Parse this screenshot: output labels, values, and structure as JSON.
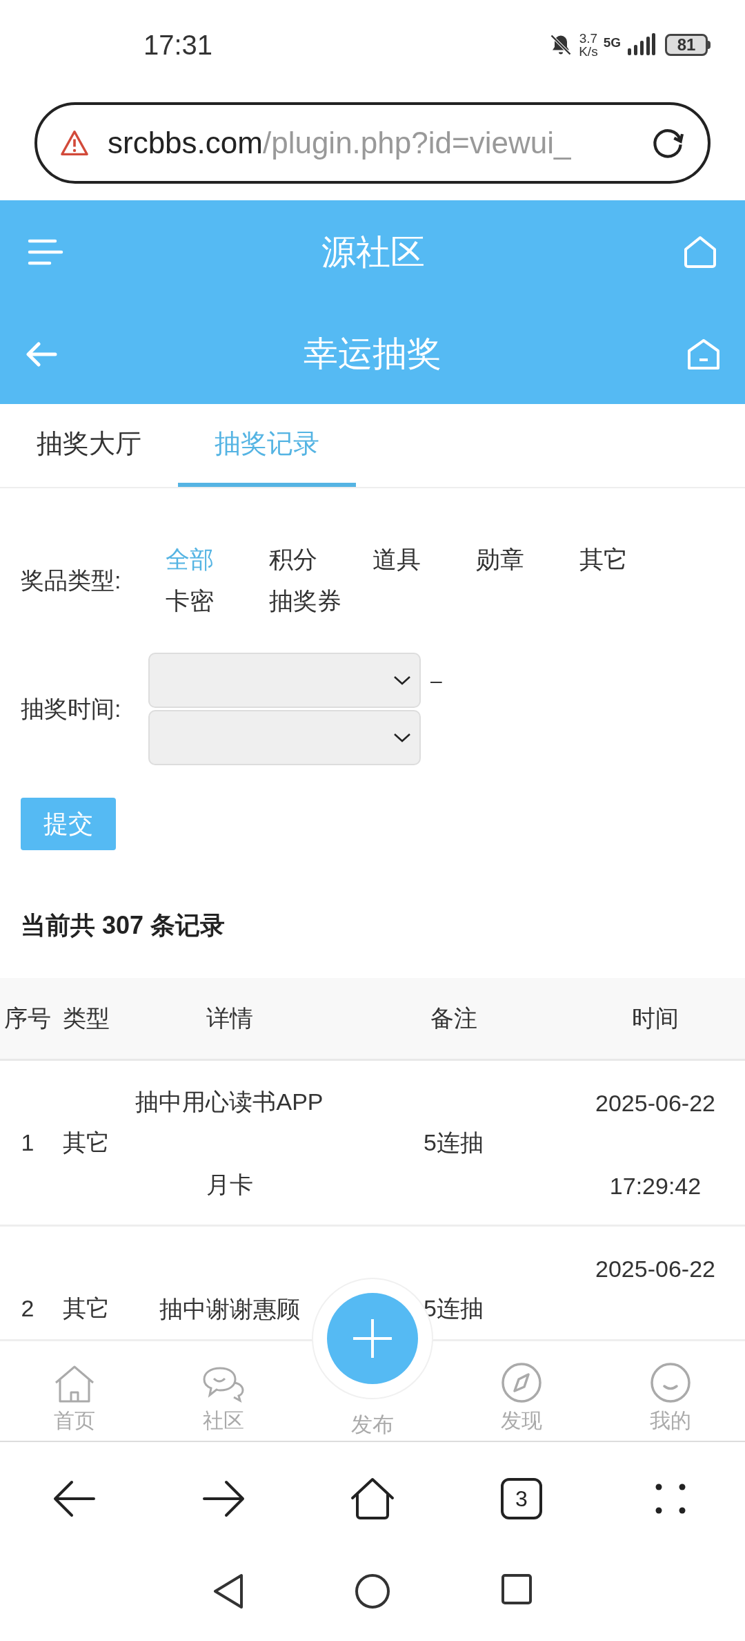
{
  "status_bar": {
    "time": "17:31",
    "speed_value": "3.7",
    "speed_unit": "K/s",
    "network": "5G",
    "battery": "81"
  },
  "address_bar": {
    "host": "srcbbs.com",
    "path": "/plugin.php?id=viewui_"
  },
  "site_header": {
    "title": "源社区"
  },
  "page_header": {
    "title": "幸运抽奖"
  },
  "tabs": [
    {
      "label": "抽奖大厅",
      "selected": false
    },
    {
      "label": "抽奖记录",
      "selected": true
    }
  ],
  "filters": {
    "prize_type": {
      "label": "奖品类型:",
      "options": [
        {
          "label": "全部",
          "selected": true
        },
        {
          "label": "积分",
          "selected": false
        },
        {
          "label": "道具",
          "selected": false
        },
        {
          "label": "勋章",
          "selected": false
        },
        {
          "label": "其它",
          "selected": false
        },
        {
          "label": "卡密",
          "selected": false
        },
        {
          "label": "抽奖券",
          "selected": false
        }
      ]
    },
    "draw_time": {
      "label": "抽奖时间:",
      "separator": "–"
    }
  },
  "submit_button": "提交",
  "record_count": "当前共 307 条记录",
  "table": {
    "columns": [
      "序号",
      "类型",
      "详情",
      "备注",
      "时间"
    ],
    "rows": [
      {
        "index": "1",
        "type": "其它",
        "detail": "抽中用心读书APP月卡",
        "note": "5连抽",
        "date": "2025-06-22",
        "time": "17:29:42"
      },
      {
        "index": "2",
        "type": "其它",
        "detail": "抽中谢谢惠顾",
        "note": "5连抽",
        "date": "2025-06-22"
      }
    ]
  },
  "bottom_nav": [
    {
      "label": "首页",
      "kind": "home"
    },
    {
      "label": "社区",
      "kind": "community"
    },
    {
      "label": "发布",
      "kind": "post"
    },
    {
      "label": "发现",
      "kind": "discover"
    },
    {
      "label": "我的",
      "kind": "profile"
    }
  ],
  "browser_toolbar": {
    "tab_count": "3"
  }
}
